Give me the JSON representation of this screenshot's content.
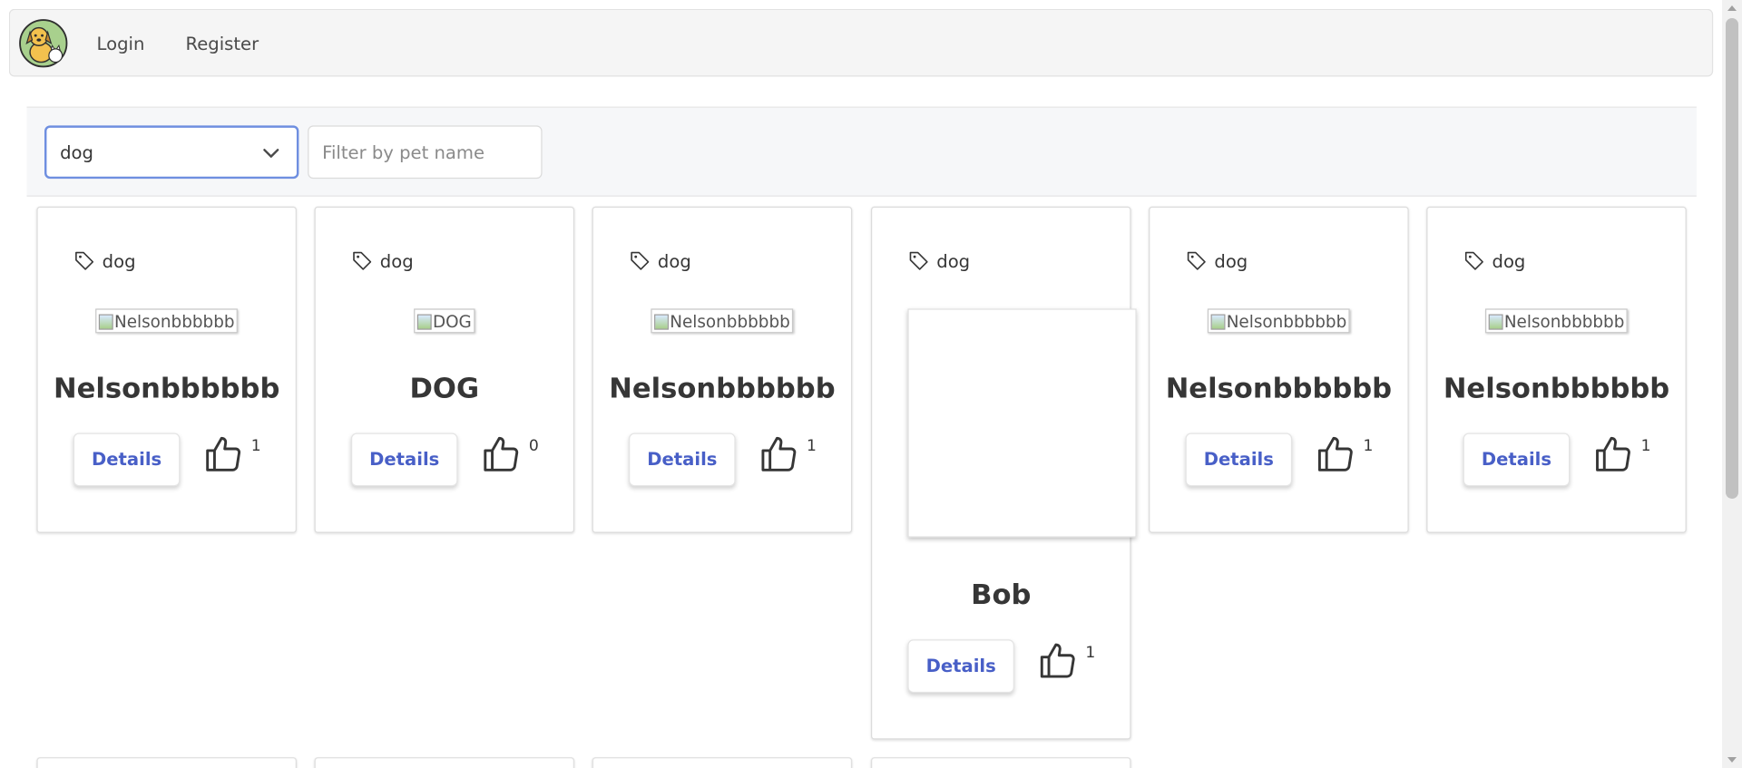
{
  "nav": {
    "login": "Login",
    "register": "Register"
  },
  "filter": {
    "selected_type": "dog",
    "name_placeholder": "Filter by pet name"
  },
  "pets": [
    {
      "tag": "dog",
      "image_alt": "Nelsonbbbbbb",
      "name": "Nelsonbbbbbb",
      "details": "Details",
      "likes": "1"
    },
    {
      "tag": "dog",
      "image_alt": "DOG",
      "name": "DOG",
      "details": "Details",
      "likes": "0"
    },
    {
      "tag": "dog",
      "image_alt": "Nelsonbbbbbb",
      "name": "Nelsonbbbbbb",
      "details": "Details",
      "likes": "1"
    },
    {
      "tag": "dog",
      "image_alt": "",
      "name": "Bob",
      "details": "Details",
      "likes": "1"
    },
    {
      "tag": "dog",
      "image_alt": "Nelsonbbbbbb",
      "name": "Nelsonbbbbbb",
      "details": "Details",
      "likes": "1"
    },
    {
      "tag": "dog",
      "image_alt": "Nelsonbbbbbb",
      "name": "Nelsonbbbbbb",
      "details": "Details",
      "likes": "1"
    }
  ]
}
